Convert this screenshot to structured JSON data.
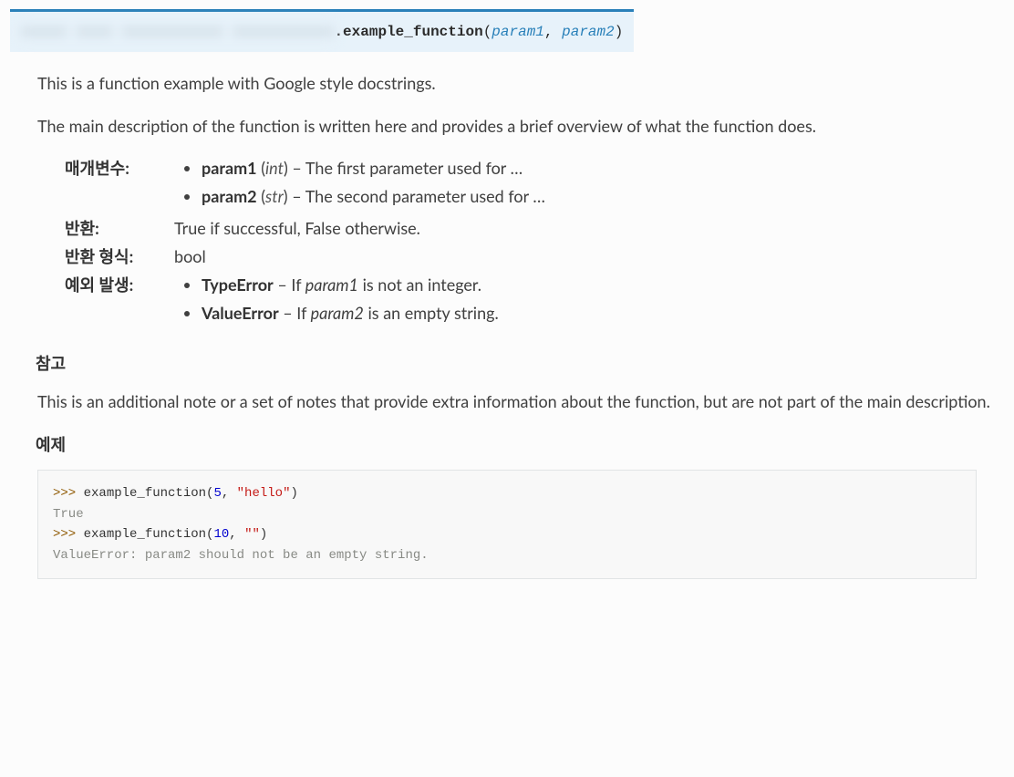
{
  "signature": {
    "prefix_blurred": "xxxxx xxxx xxxxxxxxxxx xxxxxxxxxxx",
    "funcname": ".example_function",
    "open": "(",
    "close": ")",
    "params": [
      "param1",
      "param2"
    ],
    "sep": ", "
  },
  "descriptions": [
    "This is a function example with Google style docstrings.",
    "The main description of the function is written here and provides a brief overview of what the function does."
  ],
  "fields": {
    "params_label": "매개변수:",
    "returns_label": "반환:",
    "rtype_label": "반환 형식:",
    "raises_label": "예외 발생:",
    "params": [
      {
        "name": "param1",
        "type": "int",
        "desc": " – The first parameter used for …"
      },
      {
        "name": "param2",
        "type": "str",
        "desc": " – The second parameter used for …"
      }
    ],
    "returns": "True if successful, False otherwise.",
    "rtype": "bool",
    "raises": [
      {
        "name": "TypeError",
        "dash": " – If ",
        "param": "param1",
        "rest": " is not an integer."
      },
      {
        "name": "ValueError",
        "dash": " – If ",
        "param": "param2",
        "rest": " is an empty string."
      }
    ]
  },
  "note": {
    "heading": "참고",
    "text": "This is an additional note or a set of notes that provide extra information about the function, but are not part of the main description."
  },
  "example": {
    "heading": "예제",
    "lines": [
      {
        "ps": ">>> ",
        "code_a": "example_function(",
        "arg1": "5",
        "comma": ", ",
        "arg2": "\"hello\"",
        "code_b": ")"
      },
      {
        "out": "True"
      },
      {
        "ps": ">>> ",
        "code_a": "example_function(",
        "arg1": "10",
        "comma": ", ",
        "arg2": "\"\"",
        "code_b": ")"
      },
      {
        "err": "ValueError: param2 should not be an empty string."
      }
    ]
  }
}
